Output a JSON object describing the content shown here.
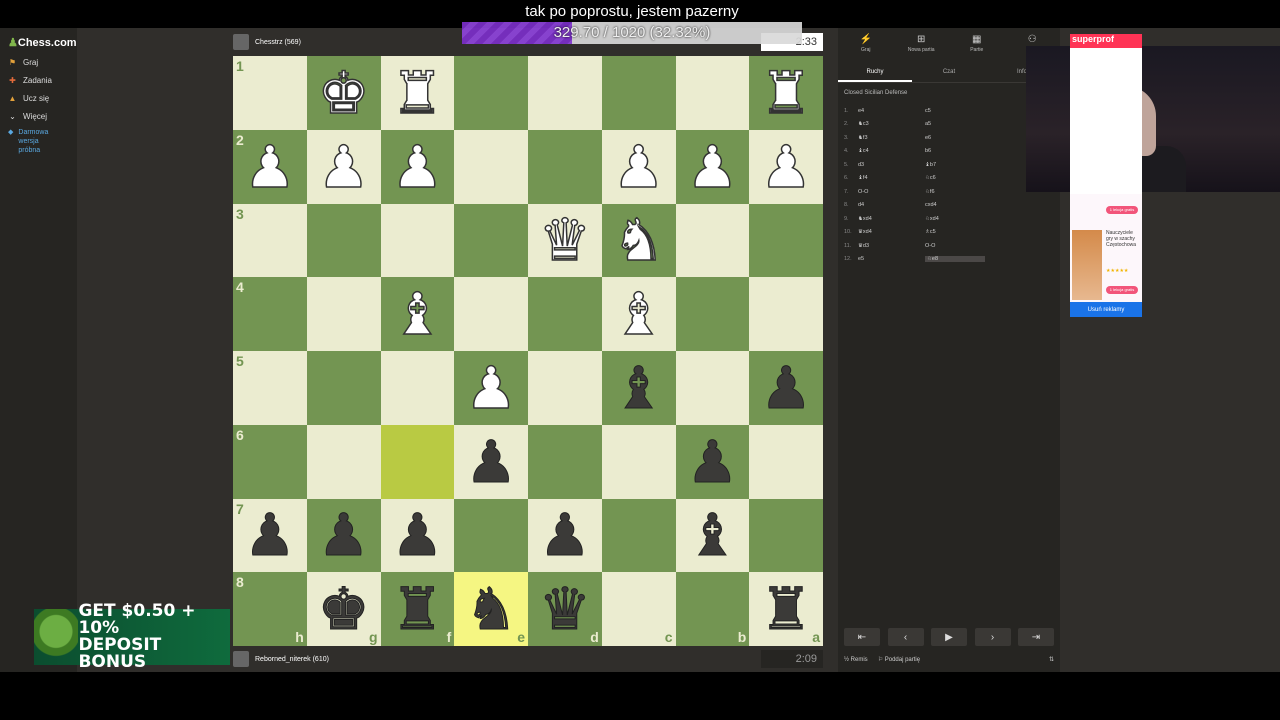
{
  "overlay": {
    "title": "tak po poprostu, jestem pazerny",
    "progress_text": "329.70 / 1020 (32.32%)",
    "progress_fraction": 0.3232
  },
  "sidebar": {
    "logo": "Chess.com",
    "items": [
      {
        "label": "Graj",
        "icon": "pawn-icon"
      },
      {
        "label": "Zadania",
        "icon": "puzzle-icon"
      },
      {
        "label": "Ucz się",
        "icon": "graduation-icon"
      },
      {
        "label": "Więcej",
        "icon": "chevron-down-icon"
      }
    ],
    "promo": "Darmowa wersja próbna"
  },
  "top_player": {
    "name": "Chesstrz (569)",
    "clock": "2:33"
  },
  "bottom_player": {
    "name": "Reborned_niterek (610)",
    "clock": "2:09"
  },
  "board": {
    "ranks": [
      "1",
      "2",
      "3",
      "4",
      "5",
      "6",
      "7",
      "8"
    ],
    "files": [
      "h",
      "g",
      "f",
      "e",
      "d",
      "c",
      "b",
      "a"
    ],
    "rows": [
      [
        "",
        "wK",
        "wR",
        "",
        "",
        "",
        "",
        "wR"
      ],
      [
        "wP",
        "wP",
        "wP",
        "",
        "",
        "wP",
        "wP",
        "wP"
      ],
      [
        "",
        "",
        "",
        "",
        "wQ",
        "wN",
        "",
        ""
      ],
      [
        "",
        "",
        "wB",
        "",
        "",
        "wB",
        "",
        ""
      ],
      [
        "",
        "",
        "",
        "wP",
        "",
        "bB",
        "",
        "bP"
      ],
      [
        "",
        "",
        "",
        "bP",
        "",
        "",
        "bP",
        ""
      ],
      [
        "bP",
        "bP",
        "bP",
        "",
        "bP",
        "",
        "bB",
        ""
      ],
      [
        "",
        "bK",
        "bR",
        "bN",
        "bQ",
        "",
        "",
        "bR"
      ]
    ],
    "highlights": [
      {
        "row": 5,
        "col": 2
      },
      {
        "row": 7,
        "col": 3
      }
    ]
  },
  "panel": {
    "top_tabs": [
      {
        "label": "Graj",
        "icon": "lightning-icon"
      },
      {
        "label": "Nowa partia",
        "icon": "plus-square-icon"
      },
      {
        "label": "Partie",
        "icon": "grid-icon"
      },
      {
        "label": "",
        "icon": "people-icon"
      }
    ],
    "sub_tabs": [
      "Ruchy",
      "Czat",
      "Infor"
    ],
    "opening": "Closed Sicilian Defense",
    "moves": [
      {
        "n": "1.",
        "w": "e4",
        "b": "c5"
      },
      {
        "n": "2.",
        "w": "♞c3",
        "b": "a5"
      },
      {
        "n": "3.",
        "w": "♞f3",
        "b": "e6"
      },
      {
        "n": "4.",
        "w": "♝c4",
        "b": "b6"
      },
      {
        "n": "5.",
        "w": "d3",
        "b": "♝b7"
      },
      {
        "n": "6.",
        "w": "♝f4",
        "b": "♘c6"
      },
      {
        "n": "7.",
        "w": "O-O",
        "b": "♘f6"
      },
      {
        "n": "8.",
        "w": "d4",
        "b": "cxd4"
      },
      {
        "n": "9.",
        "w": "♞xd4",
        "b": "♘xd4"
      },
      {
        "n": "10.",
        "w": "♛xd4",
        "b": "♗c5"
      },
      {
        "n": "11.",
        "w": "♛d3",
        "b": "O-O"
      },
      {
        "n": "12.",
        "w": "e5",
        "b": "♘e8"
      }
    ],
    "footer": {
      "draw": "Remis",
      "resign": "Poddaj partię"
    }
  },
  "ad": {
    "brand": "superprof",
    "text": "Nauczyciele gry w szachy Częstochowa",
    "pill1": "1 lekcja gratis",
    "pill2": "1 lekcja gratis",
    "stars": "★★★★★",
    "remove": "Usuń reklamy"
  },
  "bonus": {
    "line1": "GET $0.50 + 10%",
    "line2": "DEPOSIT BONUS"
  }
}
